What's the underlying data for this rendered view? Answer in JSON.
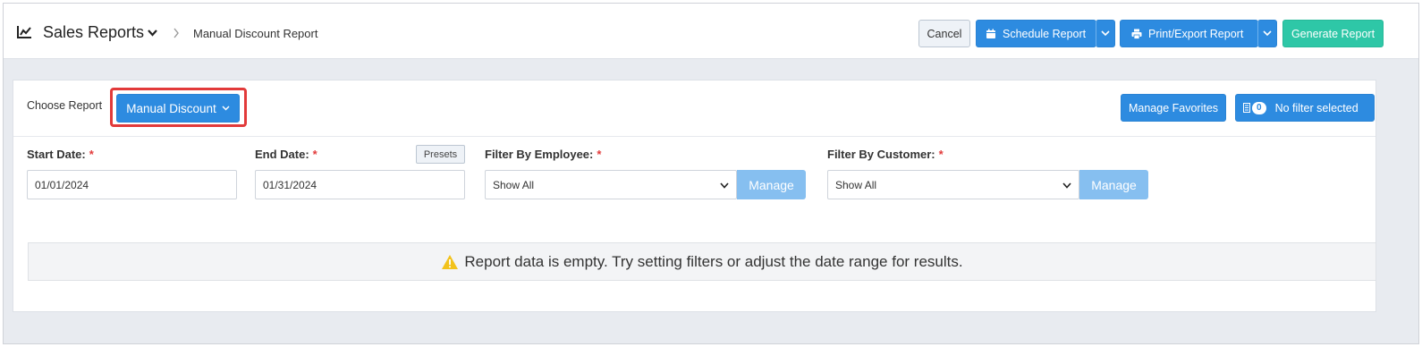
{
  "header": {
    "title": "Sales Reports",
    "breadcrumb": "Manual Discount Report",
    "buttons": {
      "cancel": "Cancel",
      "schedule": "Schedule Report",
      "print": "Print/Export Report",
      "generate": "Generate Report"
    }
  },
  "card": {
    "choose_label": "Choose Report",
    "selected_report": "Manual Discount",
    "manage_favorites": "Manage Favorites",
    "filter_count": "0",
    "filter_label": "No filter selected"
  },
  "filters": {
    "start_date": {
      "label": "Start Date:",
      "required": "*",
      "value": "01/01/2024"
    },
    "end_date": {
      "label": "End Date:",
      "required": "*",
      "value": "01/31/2024",
      "presets": "Presets"
    },
    "employee": {
      "label": "Filter By Employee:",
      "required": "*",
      "value": "Show All",
      "manage": "Manage"
    },
    "customer": {
      "label": "Filter By Customer:",
      "required": "*",
      "value": "Show All",
      "manage": "Manage"
    }
  },
  "empty_message": "Report data is empty. Try setting filters or adjust the date range for results.",
  "colors": {
    "primary": "#2d8be0",
    "success": "#2ec7a7",
    "highlight": "#e23a3a",
    "warning": "#f2c21b",
    "manage_disabled": "#86bff0"
  },
  "icons": [
    "chart-line-icon",
    "chevron-down-icon",
    "chevron-right-icon",
    "calendar-icon",
    "printer-icon",
    "filter-icon",
    "warning-icon"
  ]
}
